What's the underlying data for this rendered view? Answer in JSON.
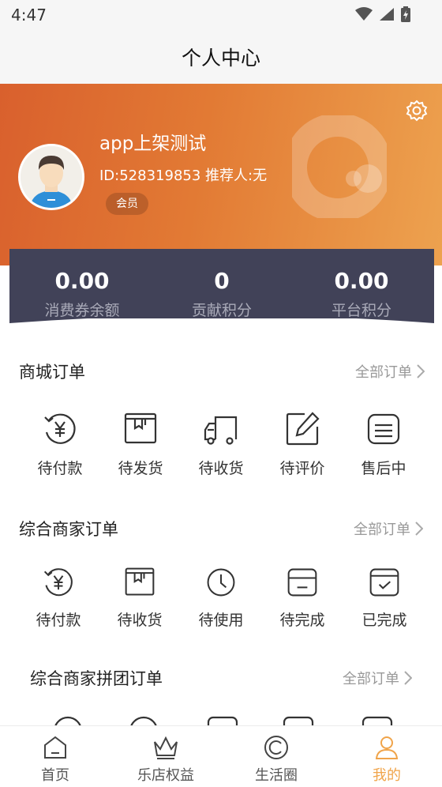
{
  "status_bar": {
    "time": "4:47"
  },
  "nav": {
    "title": "个人中心"
  },
  "profile": {
    "username": "app上架测试",
    "id_line": "ID:528319853 推荐人:无",
    "badge": "会员"
  },
  "stats": [
    {
      "value": "0.00",
      "label": "消费券余额"
    },
    {
      "value": "0",
      "label": "贡献积分"
    },
    {
      "value": "0.00",
      "label": "平台积分"
    }
  ],
  "mall_orders": {
    "title": "商城订单",
    "see_all": "全部订单",
    "items": [
      {
        "label": "待付款",
        "icon": "yen-cycle-icon"
      },
      {
        "label": "待发货",
        "icon": "box-icon"
      },
      {
        "label": "待收货",
        "icon": "truck-icon"
      },
      {
        "label": "待评价",
        "icon": "edit-icon"
      },
      {
        "label": "售后中",
        "icon": "list-card-icon"
      }
    ]
  },
  "merchant_orders": {
    "title": "综合商家订单",
    "see_all": "全部订单",
    "items": [
      {
        "label": "待付款",
        "icon": "yen-cycle-icon"
      },
      {
        "label": "待收货",
        "icon": "box-icon"
      },
      {
        "label": "待使用",
        "icon": "clock-icon"
      },
      {
        "label": "待完成",
        "icon": "card-icon"
      },
      {
        "label": "已完成",
        "icon": "card-check-icon"
      }
    ]
  },
  "group_orders": {
    "title": "综合商家拼团订单",
    "see_all": "全部订单"
  },
  "tabbar": [
    {
      "label": "首页",
      "icon": "home-icon"
    },
    {
      "label": "乐店权益",
      "icon": "crown-icon"
    },
    {
      "label": "生活圈",
      "icon": "circle-c-icon"
    },
    {
      "label": "我的",
      "icon": "user-icon",
      "active": true
    }
  ],
  "colors": {
    "accent": "#f0a44a",
    "header_start": "#d9602d",
    "header_end": "#eda24f",
    "stats_bg": "#414258"
  }
}
